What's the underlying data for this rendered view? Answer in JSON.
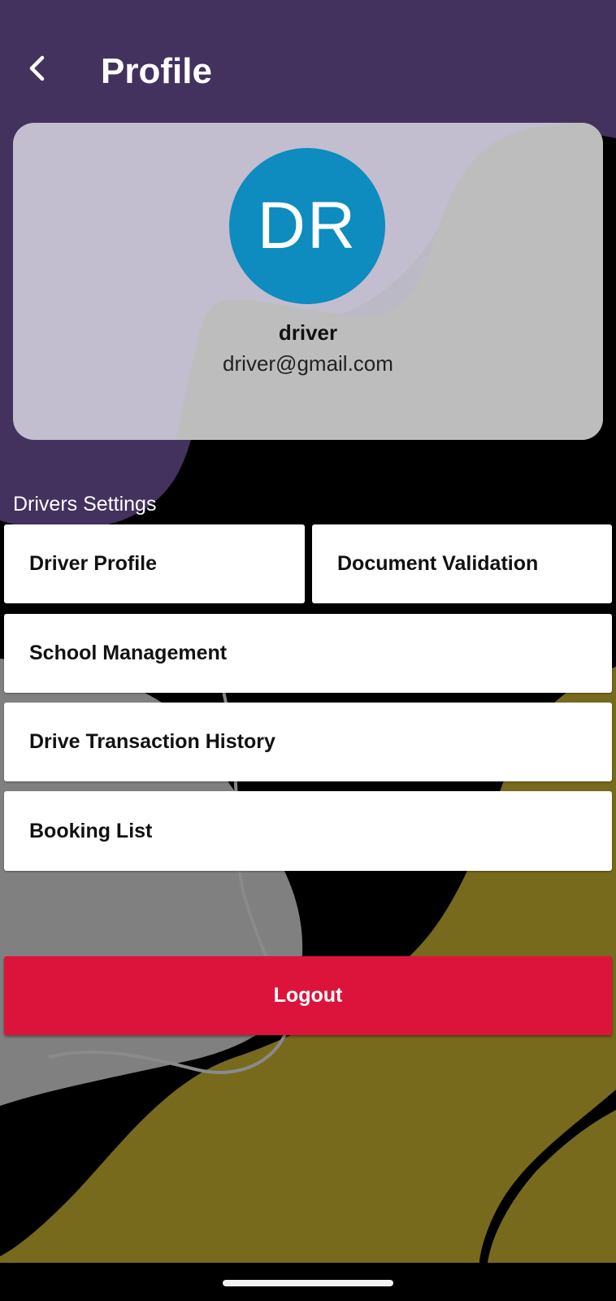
{
  "header": {
    "title": "Profile",
    "back_icon": "chevron-left-icon"
  },
  "profile": {
    "initials": "DR",
    "name": "driver",
    "email": "driver@gmail.com",
    "avatar_color": "#0E8BBF"
  },
  "settings": {
    "section_title": "Drivers Settings",
    "items": [
      {
        "label": "Driver Profile"
      },
      {
        "label": "Document Validation"
      },
      {
        "label": "School Management"
      },
      {
        "label": "Drive Transaction History"
      },
      {
        "label": "Booking List"
      }
    ]
  },
  "logout": {
    "label": "Logout",
    "color": "#DC143C"
  },
  "colors": {
    "header_purple": "#43315E",
    "olive": "#776A1D",
    "grey": "#808080",
    "background": "#000000"
  }
}
